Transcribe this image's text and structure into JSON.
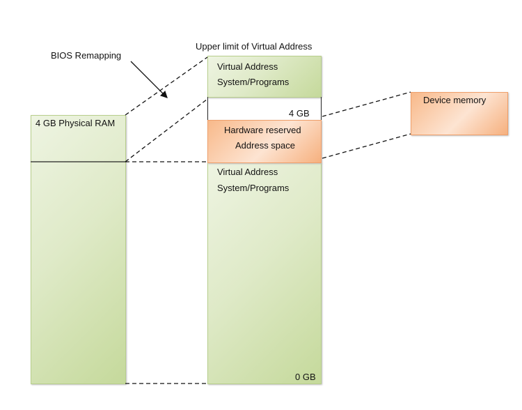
{
  "labels": {
    "bios_remapping": "BIOS Remapping",
    "upper_limit": "Upper limit of Virtual Address",
    "physical_ram": "4 GB Physical RAM",
    "virtual_top_line1": "Virtual Address",
    "virtual_top_line2": "System/Programs",
    "four_gb": "4 GB",
    "hw_reserved_line1": "Hardware reserved",
    "hw_reserved_line2": "Address space",
    "virtual_bottom_line1": "Virtual Address",
    "virtual_bottom_line2": "System/Programs",
    "zero_gb": "0 GB",
    "device_memory": "Device memory"
  },
  "colors": {
    "green": "#c5d99b",
    "orange": "#f6b07e"
  }
}
